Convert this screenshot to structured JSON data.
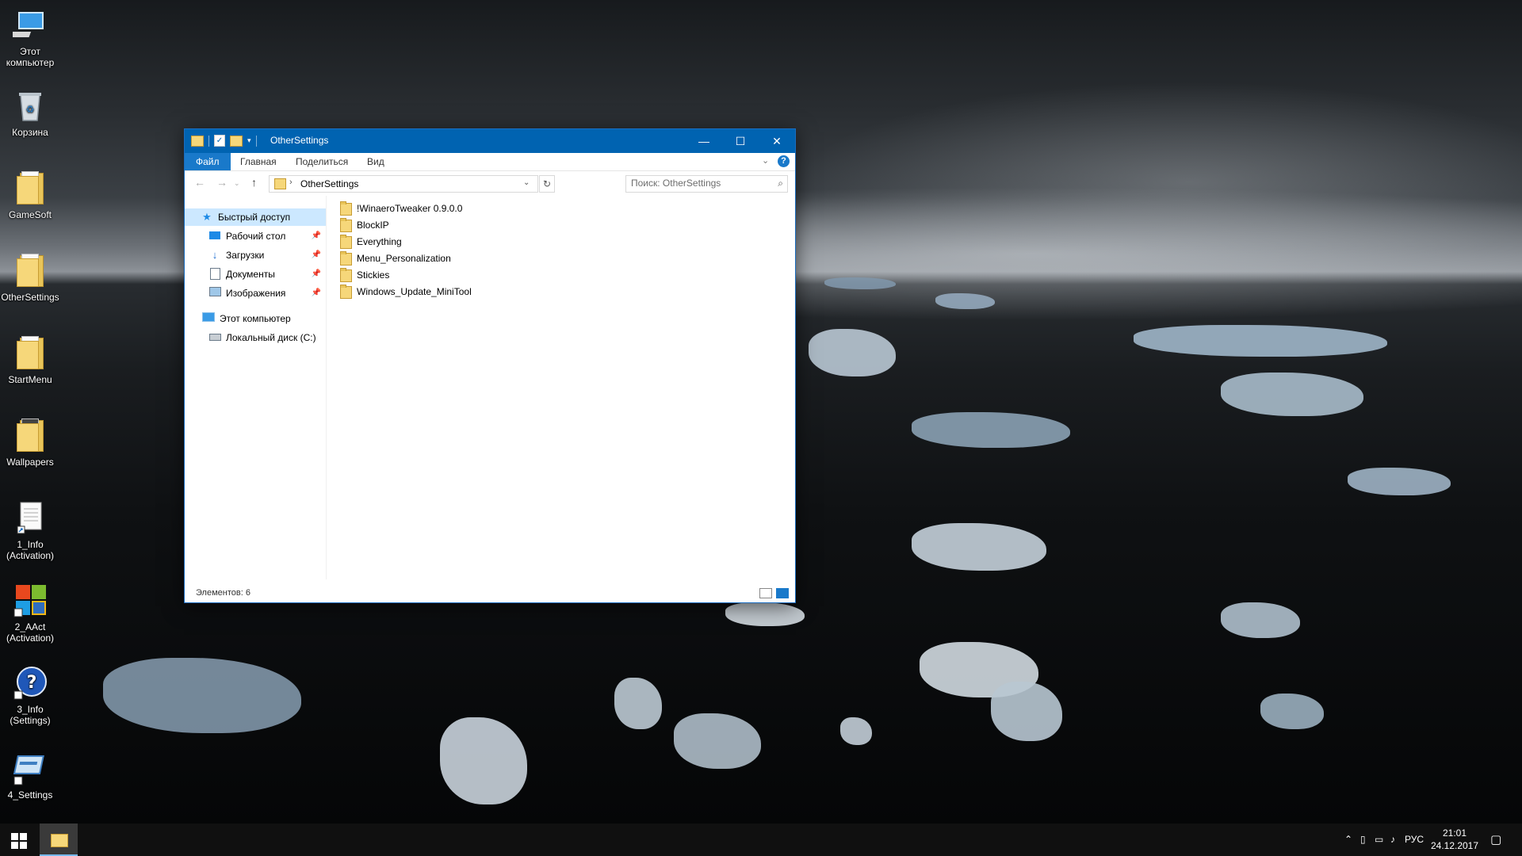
{
  "desktop": {
    "icons": [
      {
        "label": "Этот компьютер",
        "icon": "computer-icon"
      },
      {
        "label": "Корзина",
        "icon": "recycle-bin-icon"
      },
      {
        "label": "GameSoft",
        "icon": "folder-icon"
      },
      {
        "label": "OtherSettings",
        "icon": "folder-icon"
      },
      {
        "label": "StartMenu",
        "icon": "folder-icon"
      },
      {
        "label": "Wallpapers",
        "icon": "folder-icon"
      },
      {
        "label": "1_Info (Activation)",
        "icon": "text-file-shortcut-icon"
      },
      {
        "label": "2_AAct (Activation)",
        "icon": "windows-logo-shortcut-icon"
      },
      {
        "label": "3_Info (Settings)",
        "icon": "help-shortcut-icon"
      },
      {
        "label": "4_Settings",
        "icon": "settings-shortcut-icon"
      }
    ]
  },
  "window": {
    "title": "OtherSettings",
    "controls": {
      "minimize": "—",
      "maximize": "☐",
      "close": "✕"
    },
    "ribbon_tabs": [
      "Файл",
      "Главная",
      "Поделиться",
      "Вид"
    ],
    "address_path": "OtherSettings",
    "search_placeholder": "Поиск: OtherSettings",
    "nav_pane": {
      "quick_access": "Быстрый доступ",
      "pinned": [
        "Рабочий стол",
        "Загрузки",
        "Документы",
        "Изображения"
      ],
      "this_pc": "Этот компьютер",
      "local_disk": "Локальный диск (C:)"
    },
    "files": [
      "!WinaeroTweaker 0.9.0.0",
      "BlockIP",
      "Everything",
      "Menu_Personalization",
      "Stickies",
      "Windows_Update_MiniTool"
    ],
    "status": "Элементов: 6"
  },
  "taskbar": {
    "language": "РУС",
    "time": "21:01",
    "date": "24.12.2017"
  },
  "colors": {
    "accent": "#0063b1",
    "selection": "#cce8ff",
    "folder": "#f6d77a"
  }
}
